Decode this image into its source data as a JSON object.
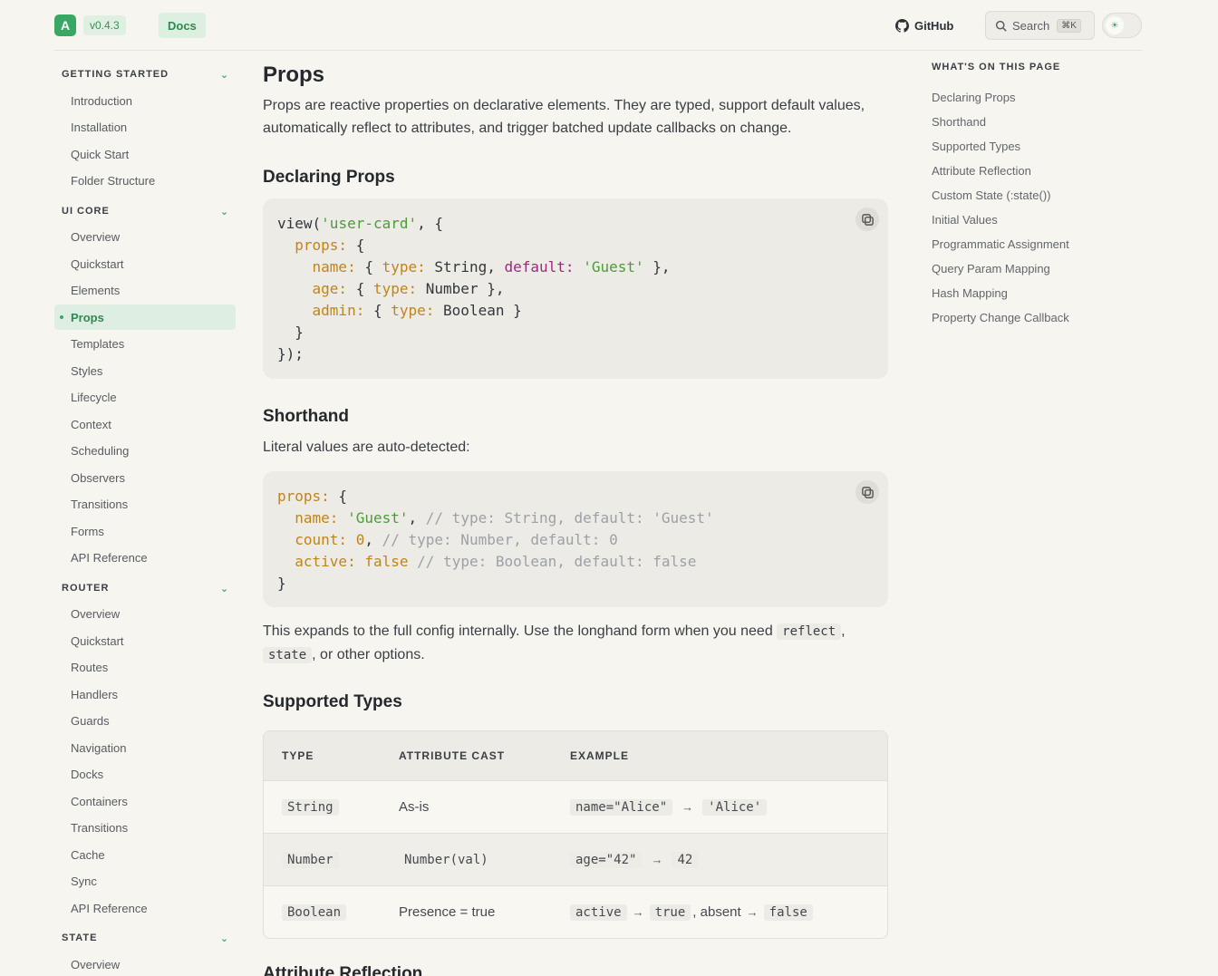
{
  "header": {
    "logo_letter": "A",
    "version": "v0.4.3",
    "docs_label": "Docs",
    "github_label": "GitHub",
    "search_label": "Search",
    "search_shortcut": "⌘K"
  },
  "sidebar": {
    "sections": [
      {
        "title": "GETTING STARTED",
        "items": [
          "Introduction",
          "Installation",
          "Quick Start",
          "Folder Structure"
        ]
      },
      {
        "title": "UI CORE",
        "items": [
          "Overview",
          "Quickstart",
          "Elements",
          "Props",
          "Templates",
          "Styles",
          "Lifecycle",
          "Context",
          "Scheduling",
          "Observers",
          "Transitions",
          "Forms",
          "API Reference"
        ]
      },
      {
        "title": "ROUTER",
        "items": [
          "Overview",
          "Quickstart",
          "Routes",
          "Handlers",
          "Guards",
          "Navigation",
          "Docks",
          "Containers",
          "Transitions",
          "Cache",
          "Sync",
          "API Reference"
        ]
      },
      {
        "title": "STATE",
        "items": [
          "Overview"
        ]
      }
    ],
    "active_item": "Props"
  },
  "main": {
    "title": "Props",
    "intro": "Props are reactive properties on declarative elements. They are typed, support default values, automatically reflect to attributes, and trigger batched update callbacks on change.",
    "declaring": {
      "heading": "Declaring Props",
      "code": {
        "l1_fn": "view(",
        "l1_str": "'user-card'",
        "l1_rest": ", {",
        "l2_key": "props:",
        "l2_rest": " {",
        "l3_key": "name:",
        "l3_a": " { ",
        "l3_type": "type:",
        "l3_b": " String, ",
        "l3_default": "default:",
        "l3_sp": " ",
        "l3_str": "'Guest'",
        "l3_c": " },",
        "l4_key": "age:",
        "l4_a": " { ",
        "l4_type": "type:",
        "l4_b": " Number },",
        "l5_key": "admin:",
        "l5_a": " { ",
        "l5_type": "type:",
        "l5_b": " Boolean }",
        "l6": "  }",
        "l7": "});"
      }
    },
    "shorthand": {
      "heading": "Shorthand",
      "text": "Literal values are auto-detected:",
      "code": {
        "l1_key": "props:",
        "l1_rest": " {",
        "l2_key": "name:",
        "l2_sp": " ",
        "l2_str": "'Guest'",
        "l2_rest": ", ",
        "l2_com": "// type: String, default: 'Guest'",
        "l3_key": "count:",
        "l3_sp": " ",
        "l3_num": "0",
        "l3_rest": ", ",
        "l3_com": "// type: Number, default: 0",
        "l4_key": "active:",
        "l4_sp": " ",
        "l4_kw": "false",
        "l4_rest": " ",
        "l4_com": "// type: Boolean, default: false",
        "l5": "}"
      },
      "after_1": "This expands to the full config internally. Use the longhand form when you need ",
      "code_reflect": "reflect",
      "after_2": ",",
      "code_state": "state",
      "after_3": ", or other options."
    },
    "types": {
      "heading": "Supported Types",
      "columns": [
        "TYPE",
        "ATTRIBUTE CAST",
        "EXAMPLE"
      ],
      "rows": [
        {
          "type": "String",
          "cast": "As-is",
          "ex_a": "name=\"Alice\"",
          "arrow": "→",
          "ex_b": "'Alice'"
        },
        {
          "type": "Number",
          "cast": "Number(val)",
          "ex_a": "age=\"42\"",
          "arrow": "→",
          "ex_b": "42"
        },
        {
          "type": "Boolean",
          "cast": "Presence = true",
          "ex_a": "active",
          "arrow": "→",
          "ex_b": "true",
          "ex_mid": ", absent",
          "arrow2": "→",
          "ex_c": "false"
        }
      ]
    },
    "next_heading": "Attribute Reflection"
  },
  "toc": {
    "title": "WHAT'S ON THIS PAGE",
    "items": [
      "Declaring Props",
      "Shorthand",
      "Supported Types",
      "Attribute Reflection",
      "Custom State (:state())",
      "Initial Values",
      "Programmatic Assignment",
      "Query Param Mapping",
      "Hash Mapping",
      "Property Change Callback"
    ]
  },
  "colors": {
    "accent": "#3aa865",
    "background": "#f6f5ef",
    "code_key": "#c0851a",
    "code_string": "#4f9a3b",
    "code_keyword": "#a1287e"
  }
}
